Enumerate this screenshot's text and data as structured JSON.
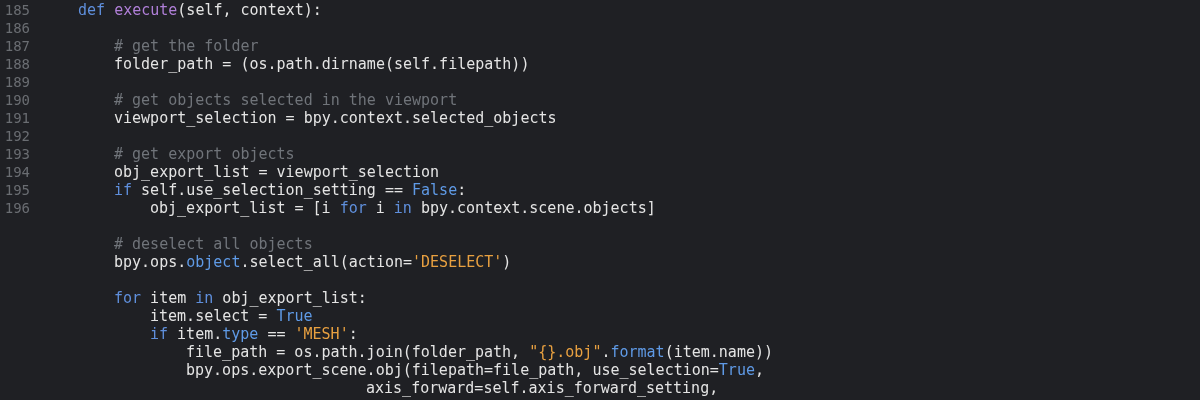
{
  "editor": {
    "lines": [
      {
        "kind": "code",
        "number": "185",
        "tokens": [
          {
            "kind": "keyword",
            "text": "def "
          },
          {
            "kind": "function",
            "text": "execute"
          },
          {
            "kind": "plain",
            "text": "(self, context):"
          }
        ],
        "children": [
          {
            "kind": "blank",
            "number": "186"
          },
          {
            "kind": "code",
            "number": "187",
            "tokens": [
              {
                "kind": "comment",
                "text": "# get the folder"
              }
            ]
          },
          {
            "kind": "code",
            "number": "188",
            "tokens": [
              {
                "kind": "plain",
                "text": "folder_path = (os.path.dirname(self.filepath))"
              }
            ]
          },
          {
            "kind": "blank",
            "number": "189"
          },
          {
            "kind": "code",
            "number": "190",
            "tokens": [
              {
                "kind": "comment",
                "text": "# get objects selected in the viewport"
              }
            ]
          },
          {
            "kind": "code",
            "number": "191",
            "tokens": [
              {
                "kind": "plain",
                "text": "viewport_selection = bpy.context.selected_objects"
              }
            ]
          },
          {
            "kind": "blank",
            "number": "192"
          },
          {
            "kind": "code",
            "number": "193",
            "tokens": [
              {
                "kind": "comment",
                "text": "# get export objects"
              }
            ]
          },
          {
            "kind": "code",
            "number": "194",
            "tokens": [
              {
                "kind": "plain",
                "text": "obj_export_list = viewport_selection"
              }
            ]
          },
          {
            "kind": "code",
            "number": "195",
            "tokens": [
              {
                "kind": "keyword",
                "text": "if"
              },
              {
                "kind": "plain",
                "text": " self.use_selection_setting == "
              },
              {
                "kind": "constant",
                "text": "False"
              },
              {
                "kind": "plain",
                "text": ":"
              }
            ],
            "children": [
              {
                "kind": "code",
                "number": "196",
                "tokens": [
                  {
                    "kind": "plain",
                    "text": "obj_export_list = [i "
                  },
                  {
                    "kind": "keyword",
                    "text": "for"
                  },
                  {
                    "kind": "plain",
                    "text": " i "
                  },
                  {
                    "kind": "keyword",
                    "text": "in"
                  },
                  {
                    "kind": "plain",
                    "text": " bpy.context.scene.objects]"
                  }
                ]
              }
            ]
          },
          {
            "kind": "blank"
          },
          {
            "kind": "code",
            "tokens": [
              {
                "kind": "comment",
                "text": "# deselect all objects"
              }
            ]
          },
          {
            "kind": "code",
            "tokens": [
              {
                "kind": "plain",
                "text": "bpy.ops."
              },
              {
                "kind": "constant",
                "text": "object"
              },
              {
                "kind": "plain",
                "text": ".select_all(action="
              },
              {
                "kind": "string",
                "text": "'DESELECT'"
              },
              {
                "kind": "plain",
                "text": ")"
              }
            ]
          },
          {
            "kind": "blank"
          },
          {
            "kind": "code",
            "tokens": [
              {
                "kind": "keyword",
                "text": "for"
              },
              {
                "kind": "plain",
                "text": " item "
              },
              {
                "kind": "keyword",
                "text": "in"
              },
              {
                "kind": "plain",
                "text": " obj_export_list:"
              }
            ],
            "children": [
              {
                "kind": "code",
                "tokens": [
                  {
                    "kind": "plain",
                    "text": "item.select = "
                  },
                  {
                    "kind": "constant",
                    "text": "True"
                  }
                ]
              },
              {
                "kind": "code",
                "tokens": [
                  {
                    "kind": "keyword",
                    "text": "if"
                  },
                  {
                    "kind": "plain",
                    "text": " item."
                  },
                  {
                    "kind": "constant",
                    "text": "type"
                  },
                  {
                    "kind": "plain",
                    "text": " == "
                  },
                  {
                    "kind": "string",
                    "text": "'MESH'"
                  },
                  {
                    "kind": "plain",
                    "text": ":"
                  }
                ],
                "children": [
                  {
                    "kind": "code",
                    "tokens": [
                      {
                        "kind": "plain",
                        "text": "file_path = os.path.join(folder_path, "
                      },
                      {
                        "kind": "string",
                        "text": "\"{}.obj\""
                      },
                      {
                        "kind": "plain",
                        "text": "."
                      },
                      {
                        "kind": "constant",
                        "text": "format"
                      },
                      {
                        "kind": "plain",
                        "text": "(item.name))"
                      }
                    ]
                  },
                  {
                    "kind": "code",
                    "tokens": [
                      {
                        "kind": "plain",
                        "text": "bpy.ops.export_scene.obj(filepath=file_path, use_selection="
                      },
                      {
                        "kind": "constant",
                        "text": "True"
                      },
                      {
                        "kind": "plain",
                        "text": ","
                      }
                    ],
                    "children": [
                      {
                        "kind": "continuation",
                        "tokens": [
                          {
                            "kind": "plain",
                            "text": "axis_forward=self.axis_forward_setting,"
                          }
                        ]
                      }
                    ]
                  }
                ]
              }
            ]
          }
        ]
      }
    ]
  }
}
